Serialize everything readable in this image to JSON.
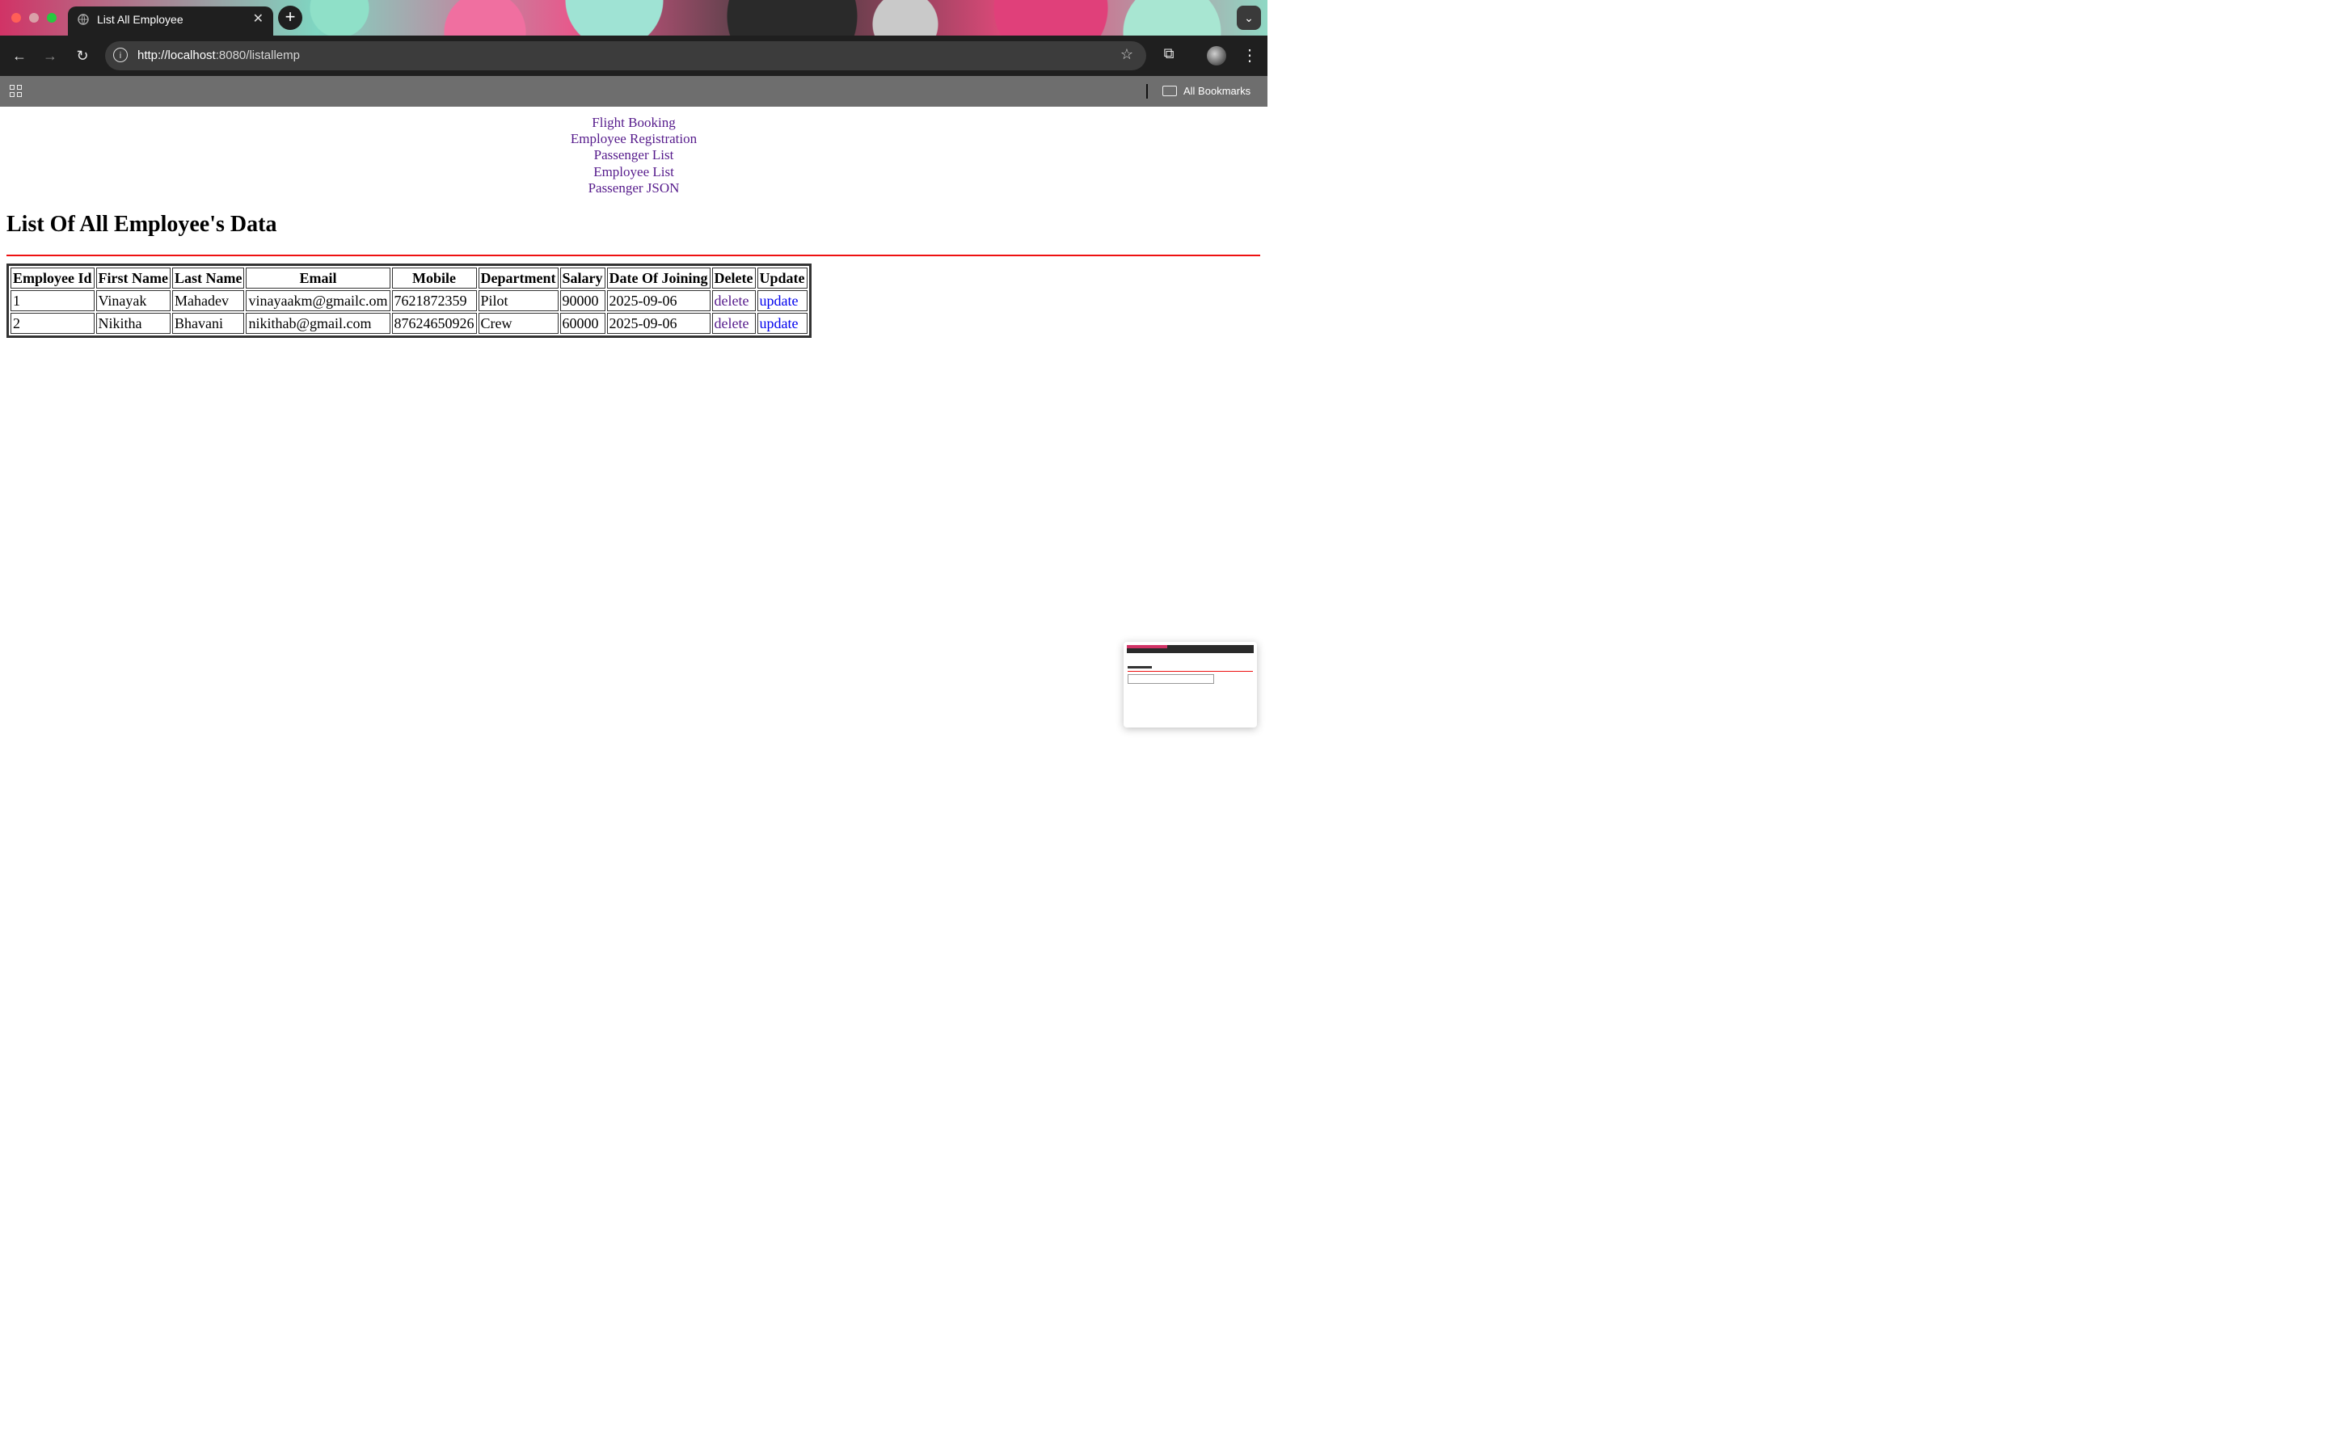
{
  "browser": {
    "tab_title": "List All Employee",
    "url_host": "http://localhost",
    "url_rest": ":8080/listallemp",
    "bookmarks_label": "All Bookmarks"
  },
  "nav": {
    "links": [
      "Flight Booking",
      "Employee Registration",
      "Passenger List",
      "Employee List",
      "Passenger JSON"
    ]
  },
  "page": {
    "heading": "List Of All Employee's Data"
  },
  "table": {
    "headers": [
      "Employee Id",
      "First Name",
      "Last Name",
      "Email",
      "Mobile",
      "Department",
      "Salary",
      "Date Of Joining",
      "Delete",
      "Update"
    ],
    "rows": [
      {
        "id": "1",
        "first": "Vinayak",
        "last": "Mahadev",
        "email": "vinayaakm@gmailc.om",
        "mobile": "7621872359",
        "dept": "Pilot",
        "salary": "90000",
        "doj": "2025-09-06",
        "delete": "delete",
        "update": "update"
      },
      {
        "id": "2",
        "first": "Nikitha",
        "last": "Bhavani",
        "email": "nikithab@gmail.com",
        "mobile": "87624650926",
        "dept": "Crew",
        "salary": "60000",
        "doj": "2025-09-06",
        "delete": "delete",
        "update": "update"
      }
    ]
  },
  "colors": {
    "visited_link": "#551a8b",
    "link": "#0000ee",
    "rule": "#ee1111"
  }
}
